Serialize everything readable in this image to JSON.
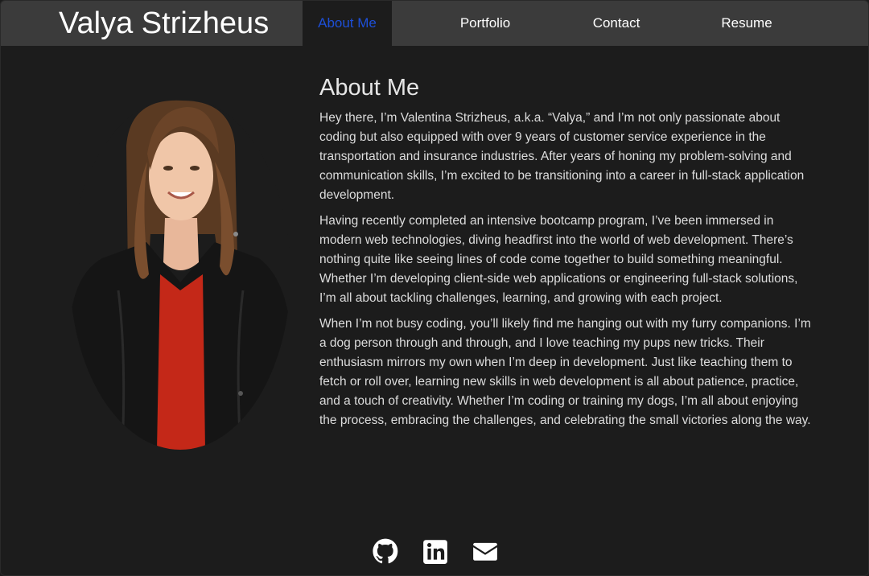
{
  "brand": {
    "name": "Valya Strizheus"
  },
  "nav": {
    "items": [
      {
        "label": "About Me",
        "active": true
      },
      {
        "label": "Portfolio",
        "active": false
      },
      {
        "label": "Contact",
        "active": false
      },
      {
        "label": "Resume",
        "active": false
      }
    ]
  },
  "about": {
    "heading": "About Me",
    "paragraphs": [
      "Hey there, I’m Valentina Strizheus, a.k.a. “Valya,” and I’m not only passionate about coding but also equipped with over 9 years of customer service experience in the transportation and insurance industries. After years of honing my problem-solving and communication skills, I’m excited to be transitioning into a career in full-stack application development.",
      "Having recently completed an intensive bootcamp program, I’ve been immersed in modern web technologies, diving headfirst into the world of web development. There’s nothing quite like seeing lines of code come together to build something meaningful. Whether I’m developing client-side web applications or engineering full-stack solutions, I’m all about tackling challenges, learning, and growing with each project.",
      "When I’m not busy coding, you’ll likely find me hanging out with my furry companions. I’m a dog person through and through, and I love teaching my pups new tricks. Their enthusiasm mirrors my own when I’m deep in development. Just like teaching them to fetch or roll over, learning new skills in web development is all about patience, practice, and a touch of creativity. Whether I’m coding or training my dogs, I’m all about enjoying the process, embracing the challenges, and celebrating the small victories along the way."
    ]
  },
  "portrait": {
    "icon": "profile-photo"
  },
  "footer": {
    "icons": [
      "github-icon",
      "linkedin-icon",
      "envelope-icon"
    ]
  },
  "colors": {
    "background": "#1c1c1c",
    "navbar": "#3b3b3b",
    "active_link": "#1d4fd8",
    "text": "#dcdcdc"
  }
}
